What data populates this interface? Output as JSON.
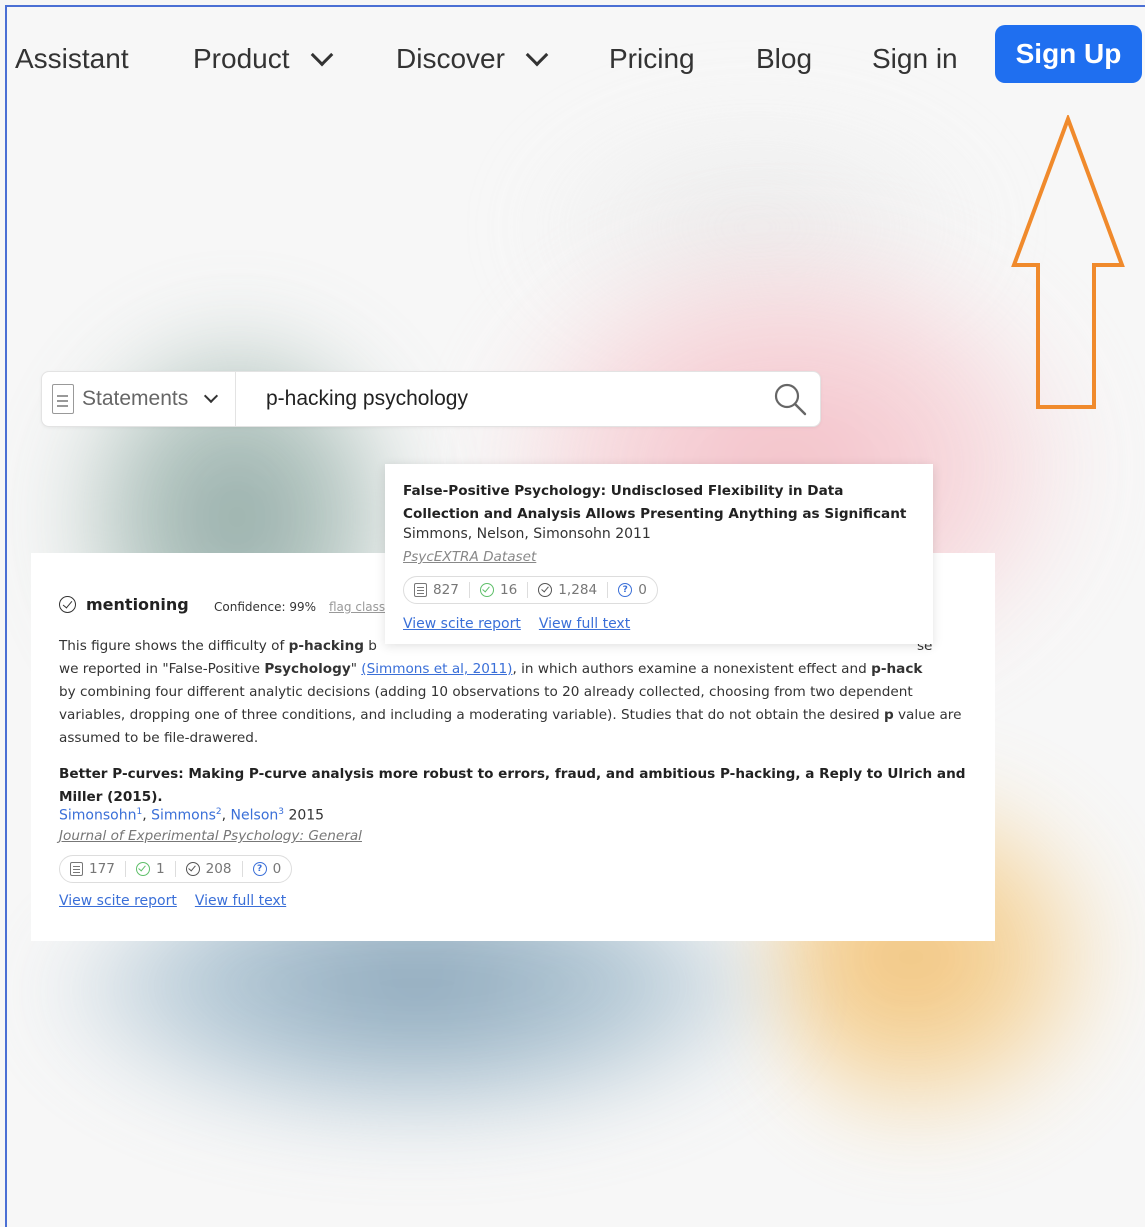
{
  "nav": {
    "items": [
      {
        "label": "Assistant",
        "dropdown": false
      },
      {
        "label": "Product",
        "dropdown": true
      },
      {
        "label": "Discover",
        "dropdown": true
      },
      {
        "label": "Pricing",
        "dropdown": false
      },
      {
        "label": "Blog",
        "dropdown": false
      },
      {
        "label": "Sign in",
        "dropdown": false
      }
    ],
    "signup_label": "Sign Up"
  },
  "search": {
    "type_label": "Statements",
    "query": "p-hacking psychology"
  },
  "card": {
    "classification": "mentioning",
    "confidence": "Confidence: 99%",
    "flag_label": "flag classification",
    "excerpt": {
      "s1": "This figure shows the difficulty of ",
      "s1_bold": "p-hacking",
      "s1_rest": " b",
      "s1_tail": "se",
      "s2": "we reported in \"False-Positive ",
      "s2_bold": "Psychology",
      "s2_quote": "\" ",
      "s2_link": "(Simmons et al, 2011)",
      "s2_rest": ", in which authors examine a nonexistent effect and ",
      "s2_bold2": "p-hack",
      "s3": "by combining four different analytic decisions (adding 10 observations to 20 already collected, choosing from two dependent variables, dropping one of three conditions, and including a moderating variable). Studies that do not obtain the desired ",
      "s3_bold": "p",
      "s3_rest": " value are assumed to be file-drawered."
    },
    "paper_title": "Better P-curves: Making P-curve analysis more robust to errors, fraud, and ambitious P-hacking, a Reply to Ulrich and Miller (2015).",
    "authors": [
      {
        "name": "Simonsohn",
        "sup": "1"
      },
      {
        "name": "Simmons",
        "sup": "2"
      },
      {
        "name": "Nelson",
        "sup": "3"
      }
    ],
    "year": "2015",
    "journal": "Journal of Experimental Psychology: General",
    "stats": {
      "publications": "177",
      "supporting": "1",
      "mentioning": "208",
      "contrasting": "0"
    },
    "view_report": "View scite report",
    "view_full": "View full text"
  },
  "popup": {
    "title": "False-Positive Psychology: Undisclosed Flexibility in Data Collection and Analysis Allows Presenting Anything as Significant",
    "authors": "Simmons, Nelson, Simonsohn 2011",
    "journal": "PsycEXTRA Dataset",
    "stats": {
      "publications": "827",
      "supporting": "16",
      "mentioning": "1,284",
      "contrasting": "0"
    },
    "view_report": "View scite report",
    "view_full": "View full text"
  },
  "annotation": {
    "arrow_color": "#f08a2c"
  },
  "colors": {
    "brand": "#1f6ff0",
    "link": "#3a6fd8"
  }
}
